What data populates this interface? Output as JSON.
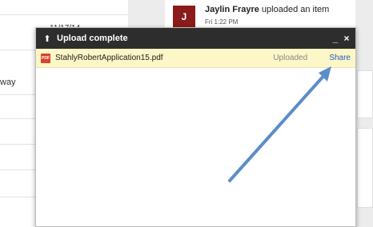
{
  "background": {
    "date_text": "11/17/14",
    "partial_text": "way",
    "activity": {
      "avatar_letter": "J",
      "user": "Jaylin Frayre",
      "action": " uploaded an item",
      "time": "Fri 1:22 PM"
    }
  },
  "dialog": {
    "title": "Upload complete",
    "minimize_symbol": "_",
    "close_symbol": "×",
    "pdf_badge": "PDF",
    "file": {
      "name": "StahlyRobertApplication15.pdf",
      "status": "Uploaded",
      "action": "Share"
    }
  },
  "colors": {
    "header_bg": "#2d2d2d",
    "file_row_bg": "#fdf6c6",
    "share_link": "#1f5ec4",
    "annotation_arrow": "#5b8dc9"
  }
}
